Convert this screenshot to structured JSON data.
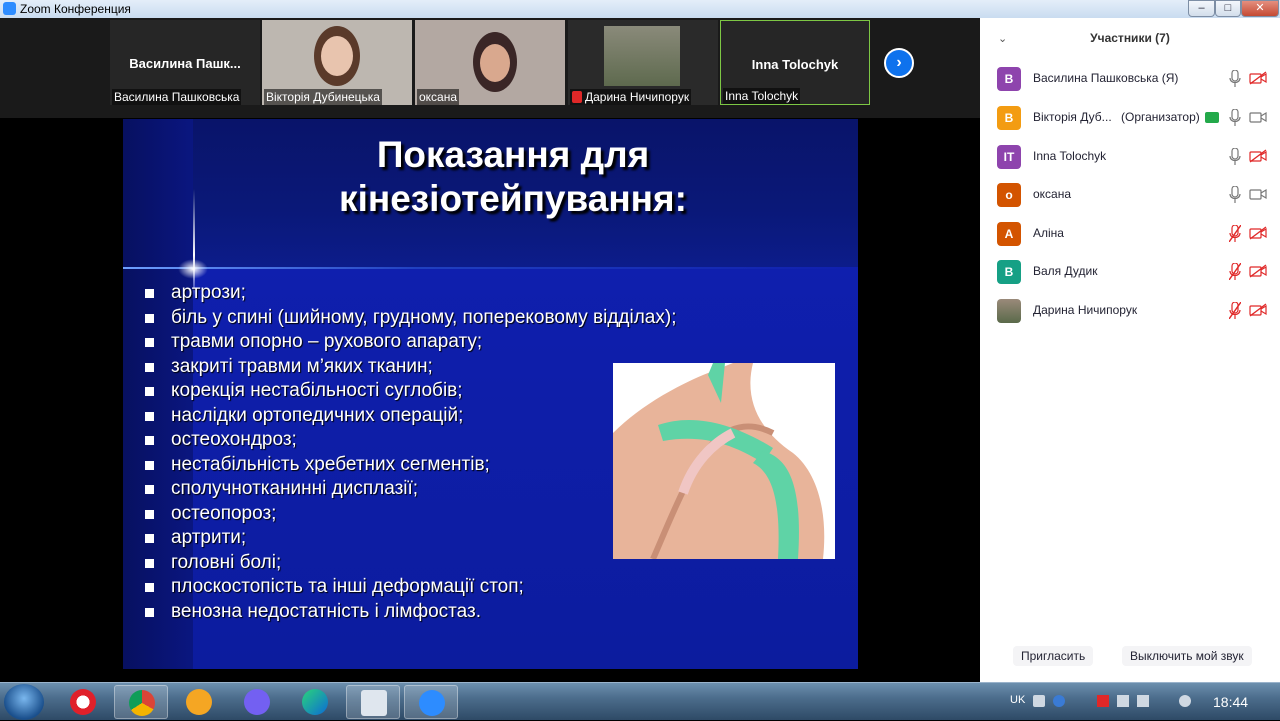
{
  "window": {
    "title": "Zoom Конференция",
    "min_label": "–",
    "max_label": "□",
    "close_label": "✕"
  },
  "video_strip": {
    "tiles": [
      {
        "name": "Василина  Пашк...",
        "label": "Василина Пашковська"
      },
      {
        "label": "Вікторія Дубинецька"
      },
      {
        "label": "оксана"
      },
      {
        "label": "Дарина Ничипорук",
        "muted": true
      },
      {
        "name": "Inna Tolochyk",
        "label": "Inna Tolochyk",
        "active_speaker": true
      }
    ],
    "next_icon": "chevron-right-icon"
  },
  "slide": {
    "title_line1": "Показання для",
    "title_line2": "кінезіотейпування:",
    "bullets": [
      "артрози;",
      "біль у спині (шийному, грудному, поперековому відділах);",
      "травми опорно – рухового апарату;",
      "закриті травми м’яких тканин;",
      "корекція нестабільності суглобів;",
      "наслідки ортопедичних операцій;",
      "остеохондроз;",
      "нестабільність хребетних сегментів;",
      "сполучнотканинні дисплазії;",
      "остеопороз;",
      "артрити;",
      "головні болі;",
      "плоскостопість та інші деформації стоп;",
      "венозна недостатність і лімфостаз."
    ],
    "image": "shoulder-kinesio-tape-photo"
  },
  "participants": {
    "header": "Участники (7)",
    "list": [
      {
        "initial": "В",
        "name": "Василина Пашковська (Я)",
        "color": "#8e44ad",
        "mic": "on",
        "video": "off"
      },
      {
        "initial": "В",
        "name": "Вікторія Дуб...",
        "role": "(Организатор)",
        "color": "#f39c12",
        "mic": "on",
        "video": "on",
        "sharing": true
      },
      {
        "initial": "IT",
        "name": "Inna Tolochyk",
        "color": "#8e44ad",
        "mic": "on",
        "video": "off"
      },
      {
        "initial": "о",
        "name": "оксана",
        "color": "#d35400",
        "mic": "on",
        "video": "on"
      },
      {
        "initial": "А",
        "name": "Аліна",
        "color": "#d35400",
        "mic": "off",
        "video": "off"
      },
      {
        "initial": "В",
        "name": "Валя Дудик",
        "color": "#16a085",
        "mic": "off",
        "video": "off"
      },
      {
        "initial": "",
        "name": "Дарина Ничипорук",
        "color": "#7a6a5a",
        "mic": "off",
        "video": "off"
      }
    ],
    "invite_label": "Пригласить",
    "mute_label": "Выключить мой звук"
  },
  "taskbar": {
    "apps": [
      "opera-icon",
      "chrome-icon",
      "vpn-icon",
      "viber-icon",
      "edge-icon",
      "screen-keyboard-icon",
      "zoom-icon"
    ],
    "language": "UK",
    "time": "18:44"
  }
}
